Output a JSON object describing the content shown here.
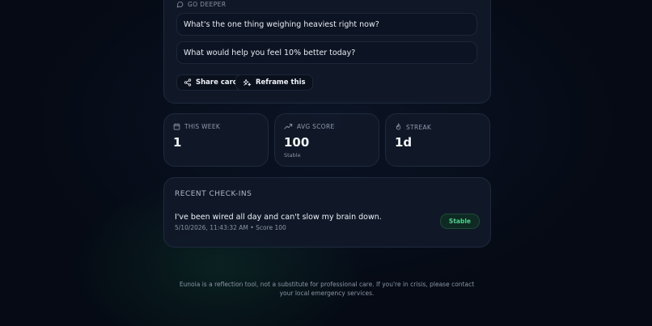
{
  "go_deeper": {
    "label": "GO DEEPER",
    "prompts": [
      "What's the one thing weighing heaviest right now?",
      "What would help you feel 10% better today?"
    ]
  },
  "actions": {
    "share_label": "Share card",
    "reframe_label": "Reframe this"
  },
  "stats": {
    "week": {
      "label": "THIS WEEK",
      "value": "1"
    },
    "score": {
      "label": "AVG SCORE",
      "value": "100",
      "sub": "Stable"
    },
    "streak": {
      "label": "STREAK",
      "value": "1d"
    }
  },
  "recent": {
    "title": "RECENT CHECK-INS",
    "entries": [
      {
        "text": "I've been wired all day and can't slow my brain down.",
        "meta": "5/10/2026, 11:43:32 AM • Score 100",
        "badge": "Stable"
      }
    ]
  },
  "footer": {
    "disclaimer": "Eunoia is a reflection tool, not a substitute for professional care. If you're in crisis, please contact your local emergency services."
  },
  "icons": {
    "chat": "chat-bubble-icon",
    "share": "share-icon",
    "reframe": "sparkles-icon",
    "week": "calendar-icon",
    "score": "trending-up-icon",
    "streak": "flame-icon"
  },
  "colors": {
    "background": "#050a14",
    "card": "#111929",
    "accent_green": "#4fd08f"
  }
}
